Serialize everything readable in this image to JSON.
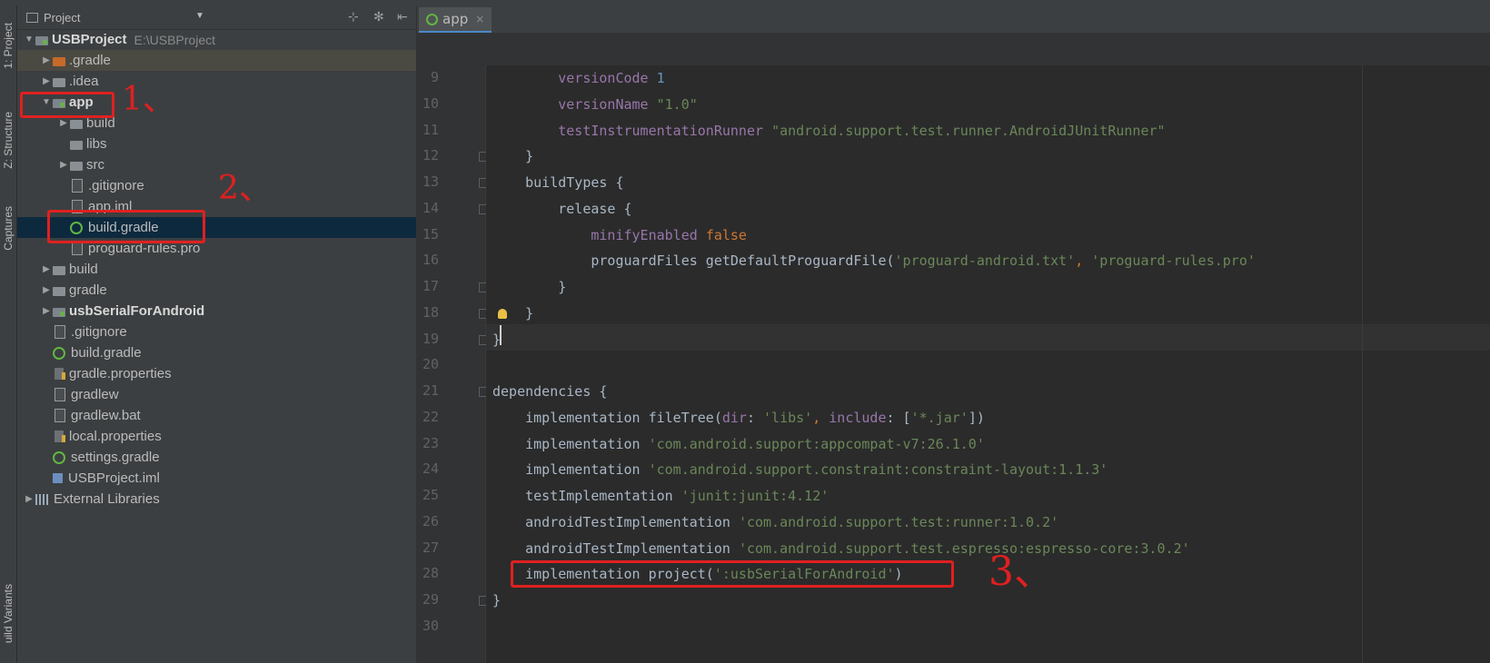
{
  "side_tabs": [
    "1: Project",
    "Z: Structure",
    "Captures",
    "uild Variants"
  ],
  "project_panel": {
    "title": "Project",
    "icons": [
      "project-view-icon",
      "dropdown-caret-icon",
      "collapse-all-icon",
      "settings-gear-icon",
      "hide-panel-icon"
    ],
    "tree": [
      {
        "label": "USBProject",
        "suffix": "E:\\USBProject",
        "depth": 0,
        "arrow": "down",
        "icon": "module-icon",
        "bold": true
      },
      {
        "label": ".gradle",
        "depth": 1,
        "arrow": "right",
        "icon": "folder-orange-icon",
        "state": "hover"
      },
      {
        "label": ".idea",
        "depth": 1,
        "arrow": "right",
        "icon": "folder-icon"
      },
      {
        "label": "app",
        "depth": 1,
        "arrow": "down",
        "icon": "module-icon",
        "bold": true
      },
      {
        "label": "build",
        "depth": 2,
        "arrow": "right",
        "icon": "folder-icon"
      },
      {
        "label": "libs",
        "depth": 2,
        "arrow": "",
        "icon": "folder-icon"
      },
      {
        "label": "src",
        "depth": 2,
        "arrow": "right",
        "icon": "folder-icon"
      },
      {
        "label": ".gitignore",
        "depth": 2,
        "arrow": "",
        "icon": "file-icon"
      },
      {
        "label": "app.iml",
        "depth": 2,
        "arrow": "",
        "icon": "file-icon"
      },
      {
        "label": "build.gradle",
        "depth": 2,
        "arrow": "",
        "icon": "gradle-icon",
        "state": "selected"
      },
      {
        "label": "proguard-rules.pro",
        "depth": 2,
        "arrow": "",
        "icon": "file-icon"
      },
      {
        "label": "build",
        "depth": 1,
        "arrow": "right",
        "icon": "folder-icon"
      },
      {
        "label": "gradle",
        "depth": 1,
        "arrow": "right",
        "icon": "folder-icon"
      },
      {
        "label": "usbSerialForAndroid",
        "depth": 1,
        "arrow": "right",
        "icon": "module-icon",
        "bold": true
      },
      {
        "label": ".gitignore",
        "depth": 1,
        "arrow": "",
        "icon": "file-icon"
      },
      {
        "label": "build.gradle",
        "depth": 1,
        "arrow": "",
        "icon": "gradle-icon"
      },
      {
        "label": "gradle.properties",
        "depth": 1,
        "arrow": "",
        "icon": "properties-icon"
      },
      {
        "label": "gradlew",
        "depth": 1,
        "arrow": "",
        "icon": "file-icon"
      },
      {
        "label": "gradlew.bat",
        "depth": 1,
        "arrow": "",
        "icon": "file-icon"
      },
      {
        "label": "local.properties",
        "depth": 1,
        "arrow": "",
        "icon": "properties-icon"
      },
      {
        "label": "settings.gradle",
        "depth": 1,
        "arrow": "",
        "icon": "gradle-icon"
      },
      {
        "label": "USBProject.iml",
        "depth": 1,
        "arrow": "",
        "icon": "iml-icon"
      },
      {
        "label": "External Libraries",
        "depth": 0,
        "arrow": "right",
        "icon": "libraries-icon"
      }
    ]
  },
  "editor_tab": {
    "label": "app",
    "close": "×"
  },
  "editor": {
    "lines": [
      {
        "n": "9",
        "code": [
          [
            "",
            "        "
          ],
          [
            "k",
            "versionCode "
          ],
          [
            "n",
            "1"
          ]
        ]
      },
      {
        "n": "10",
        "code": [
          [
            "",
            "        "
          ],
          [
            "k",
            "versionName "
          ],
          [
            "s",
            "\"1.0\""
          ]
        ]
      },
      {
        "n": "11",
        "code": [
          [
            "",
            "        "
          ],
          [
            "k",
            "testInstrumentationRunner "
          ],
          [
            "s",
            "\"android.support.test.runner.AndroidJUnitRunner\""
          ]
        ]
      },
      {
        "n": "12",
        "code": [
          [
            "",
            "    }"
          ]
        ]
      },
      {
        "n": "13",
        "code": [
          [
            "",
            "    buildTypes {"
          ]
        ]
      },
      {
        "n": "14",
        "code": [
          [
            "",
            "        release {"
          ]
        ]
      },
      {
        "n": "15",
        "code": [
          [
            "",
            "            "
          ],
          [
            "k",
            "minifyEnabled "
          ],
          [
            "o",
            "false"
          ]
        ]
      },
      {
        "n": "16",
        "code": [
          [
            "",
            "            proguardFiles getDefaultProguardFile("
          ],
          [
            "s",
            "'proguard-android.txt'"
          ],
          [
            "o",
            ", "
          ],
          [
            "s",
            "'proguard-rules.pro'"
          ]
        ]
      },
      {
        "n": "17",
        "code": [
          [
            "",
            "        }"
          ]
        ]
      },
      {
        "n": "18",
        "code": [
          [
            "",
            "    }"
          ]
        ]
      },
      {
        "n": "19",
        "code": [
          [
            "",
            "}"
          ]
        ]
      },
      {
        "n": "20",
        "code": [
          [
            "",
            ""
          ]
        ]
      },
      {
        "n": "21",
        "code": [
          [
            "",
            "dependencies {"
          ]
        ]
      },
      {
        "n": "22",
        "code": [
          [
            "",
            "    implementation fileTree("
          ],
          [
            "k",
            "dir"
          ],
          [
            "",
            ": "
          ],
          [
            "s",
            "'libs'"
          ],
          [
            "o",
            ", "
          ],
          [
            "k",
            "include"
          ],
          [
            "",
            ": ["
          ],
          [
            "s",
            "'*.jar'"
          ],
          [
            "",
            "])"
          ]
        ]
      },
      {
        "n": "23",
        "code": [
          [
            "",
            "    implementation "
          ],
          [
            "s",
            "'com.android.support:appcompat-v7:26.1.0'"
          ]
        ]
      },
      {
        "n": "24",
        "code": [
          [
            "",
            "    implementation "
          ],
          [
            "s",
            "'com.android.support.constraint:constraint-layout:1.1.3'"
          ]
        ]
      },
      {
        "n": "25",
        "code": [
          [
            "",
            "    testImplementation "
          ],
          [
            "s",
            "'junit:junit:4.12'"
          ]
        ]
      },
      {
        "n": "26",
        "code": [
          [
            "",
            "    androidTestImplementation "
          ],
          [
            "s",
            "'com.android.support.test:runner:1.0.2'"
          ]
        ]
      },
      {
        "n": "27",
        "code": [
          [
            "",
            "    androidTestImplementation "
          ],
          [
            "s",
            "'com.android.support.test.espresso:espresso-core:3.0.2'"
          ]
        ]
      },
      {
        "n": "28",
        "code": [
          [
            "",
            "    implementation project("
          ],
          [
            "s",
            "':usbSerialForAndroid'"
          ],
          [
            "",
            ")"
          ]
        ]
      },
      {
        "n": "29",
        "code": [
          [
            "",
            "}"
          ]
        ]
      },
      {
        "n": "30",
        "code": [
          [
            "",
            ""
          ]
        ]
      }
    ]
  },
  "annotations": [
    "1、",
    "2、",
    "3、"
  ],
  "colors": {
    "annotation": "#e02020",
    "selection": "#0d293e",
    "tab_accent": "#4a88c7"
  }
}
